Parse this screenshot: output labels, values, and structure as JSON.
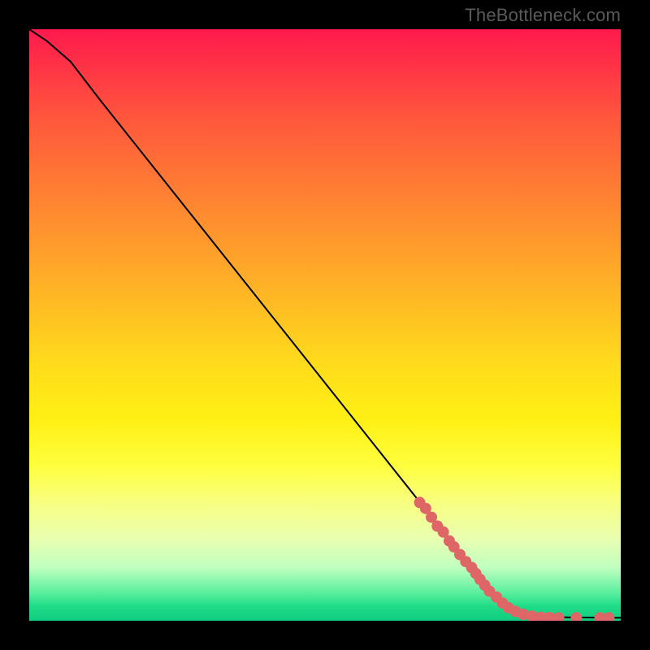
{
  "watermark": "TheBottleneck.com",
  "colors": {
    "marker": "#de6666",
    "curve": "#000000",
    "background_top": "#ff1a4d",
    "background_bottom": "#10cc80"
  },
  "chart_data": {
    "type": "line",
    "title": "",
    "xlabel": "",
    "ylabel": "",
    "xlim": [
      0,
      100
    ],
    "ylim": [
      0,
      100
    ],
    "curve_points": [
      {
        "x": 0,
        "y": 100
      },
      {
        "x": 3,
        "y": 98
      },
      {
        "x": 7,
        "y": 94.5
      },
      {
        "x": 12,
        "y": 88
      },
      {
        "x": 78,
        "y": 5
      },
      {
        "x": 81,
        "y": 2.5
      },
      {
        "x": 84,
        "y": 1.2
      },
      {
        "x": 88,
        "y": 0.6
      },
      {
        "x": 100,
        "y": 0.5
      }
    ],
    "markers": [
      {
        "x": 66,
        "y": 20
      },
      {
        "x": 67,
        "y": 19
      },
      {
        "x": 68,
        "y": 17.5
      },
      {
        "x": 69,
        "y": 16
      },
      {
        "x": 70,
        "y": 15
      },
      {
        "x": 71,
        "y": 13.5
      },
      {
        "x": 71.8,
        "y": 12.5
      },
      {
        "x": 72.8,
        "y": 11.2
      },
      {
        "x": 73.8,
        "y": 10
      },
      {
        "x": 74.8,
        "y": 9
      },
      {
        "x": 75.5,
        "y": 8
      },
      {
        "x": 76.2,
        "y": 7
      },
      {
        "x": 77,
        "y": 6
      },
      {
        "x": 77.8,
        "y": 5
      },
      {
        "x": 79,
        "y": 4
      },
      {
        "x": 80,
        "y": 3
      },
      {
        "x": 81,
        "y": 2.2
      },
      {
        "x": 82.2,
        "y": 1.6
      },
      {
        "x": 83.5,
        "y": 1.1
      },
      {
        "x": 85,
        "y": 0.8
      },
      {
        "x": 86.5,
        "y": 0.6
      },
      {
        "x": 88,
        "y": 0.55
      },
      {
        "x": 89.5,
        "y": 0.5
      },
      {
        "x": 92.5,
        "y": 0.5
      },
      {
        "x": 96.5,
        "y": 0.5
      },
      {
        "x": 98,
        "y": 0.5
      }
    ],
    "marker_radius": 7
  }
}
